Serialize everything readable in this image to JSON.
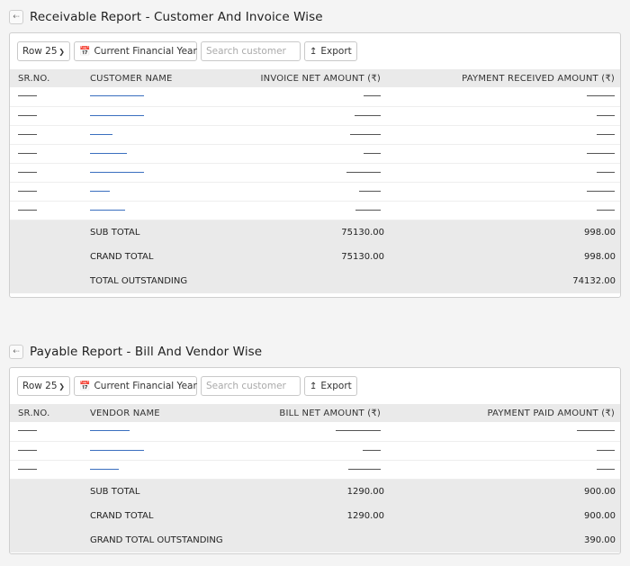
{
  "receivable": {
    "title": "Receivable Report - Customer And Invoice Wise",
    "toolbar": {
      "rows": "Row 25",
      "period": "Current Financial Year",
      "search_placeholder": "Search customer",
      "export": "Export"
    },
    "columns": [
      "SR.NO.",
      "CUSTOMER NAME",
      "INVOICE NET AMOUNT (₹)",
      "PAYMENT RECEIVED AMOUNT (₹)"
    ],
    "totals": {
      "sub_total_label": "SUB TOTAL",
      "sub_total_amount": "75130.00",
      "sub_total_received": "998.00",
      "grand_total_label": "CRAND TOTAL",
      "grand_total_amount": "75130.00",
      "grand_total_received": "998.00",
      "outstanding_label": "TOTAL OUTSTANDING",
      "outstanding_amount": "74132.00"
    }
  },
  "payable": {
    "title": "Payable Report - Bill And Vendor Wise",
    "toolbar": {
      "rows": "Row 25",
      "period": "Current Financial Year",
      "search_placeholder": "Search customer",
      "export": "Export"
    },
    "columns": [
      "SR.NO.",
      "VENDOR NAME",
      "BILL NET AMOUNT (₹)",
      "PAYMENT PAID AMOUNT (₹)"
    ],
    "totals": {
      "sub_total_label": "SUB TOTAL",
      "sub_total_amount": "1290.00",
      "sub_total_paid": "900.00",
      "grand_total_label": "CRAND TOTAL",
      "grand_total_amount": "1290.00",
      "grand_total_paid": "900.00",
      "outstanding_label": "GRAND TOTAL OUTSTANDING",
      "outstanding_amount": "390.00"
    }
  },
  "icons": {
    "back": "arrow-left-icon",
    "calendar": "calendar-icon",
    "export": "upload-icon",
    "dropdown": "chevron-down-icon"
  },
  "colors": {
    "link": "#3a6fbf",
    "header_bg": "#eaeaea",
    "page_bg": "#f4f4f4"
  }
}
